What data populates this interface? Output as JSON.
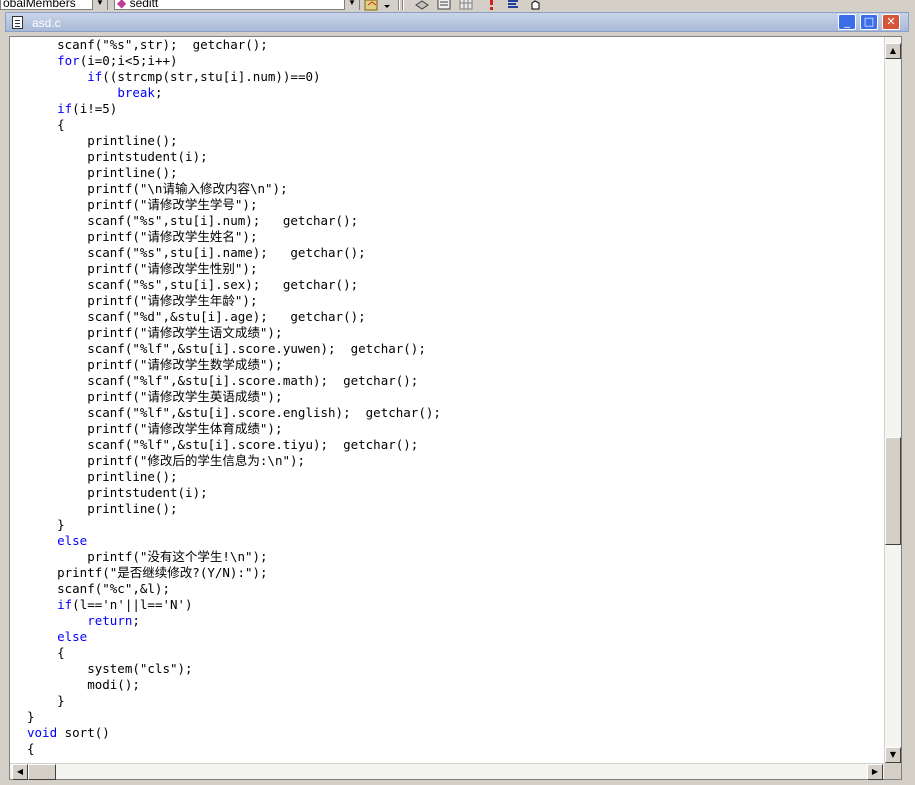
{
  "toolbar": {
    "class_combo_value": "obalMembers",
    "member_combo_value": "seditt"
  },
  "window": {
    "title": "asd.c",
    "min_label": "_",
    "max_label": "□",
    "close_label": "✕"
  },
  "scrollbar": {
    "up_arrow": "▲",
    "down_arrow": "▼",
    "left_arrow": "◀",
    "right_arrow": "▶"
  },
  "code_lines": [
    "    scanf(\"%s\",str);  getchar();",
    "    for(i=0;i<5;i++)",
    "        if((strcmp(str,stu[i].num))==0)",
    "            break;",
    "    if(i!=5)",
    "    {",
    "        printline();",
    "        printstudent(i);",
    "        printline();",
    "        printf(\"\\n请输入修改内容\\n\");",
    "        printf(\"请修改学生学号\");",
    "        scanf(\"%s\",stu[i].num);   getchar();",
    "        printf(\"请修改学生姓名\");",
    "        scanf(\"%s\",stu[i].name);   getchar();",
    "        printf(\"请修改学生性别\");",
    "        scanf(\"%s\",stu[i].sex);   getchar();",
    "        printf(\"请修改学生年龄\");",
    "        scanf(\"%d\",&stu[i].age);   getchar();",
    "        printf(\"请修改学生语文成绩\");",
    "        scanf(\"%lf\",&stu[i].score.yuwen);  getchar();",
    "        printf(\"请修改学生数学成绩\");",
    "        scanf(\"%lf\",&stu[i].score.math);  getchar();",
    "        printf(\"请修改学生英语成绩\");",
    "        scanf(\"%lf\",&stu[i].score.english);  getchar();",
    "        printf(\"请修改学生体育成绩\");",
    "        scanf(\"%lf\",&stu[i].score.tiyu);  getchar();",
    "        printf(\"修改后的学生信息为:\\n\");",
    "        printline();",
    "        printstudent(i);",
    "        printline();",
    "    }",
    "    else",
    "        printf(\"没有这个学生!\\n\");",
    "    printf(\"是否继续修改?(Y/N):\");",
    "    scanf(\"%c\",&l);",
    "    if(l=='n'||l=='N')",
    "        return;",
    "    else",
    "    {",
    "        system(\"cls\");",
    "        modi();",
    "    }",
    "}",
    "void sort()",
    "{"
  ],
  "keywords": [
    "for",
    "if",
    "break",
    "else",
    "return",
    "void"
  ],
  "colors": {
    "keyword": "#0000ff",
    "text": "#000000",
    "background": "#ffffff",
    "titlebar": "#a8b9d8"
  }
}
